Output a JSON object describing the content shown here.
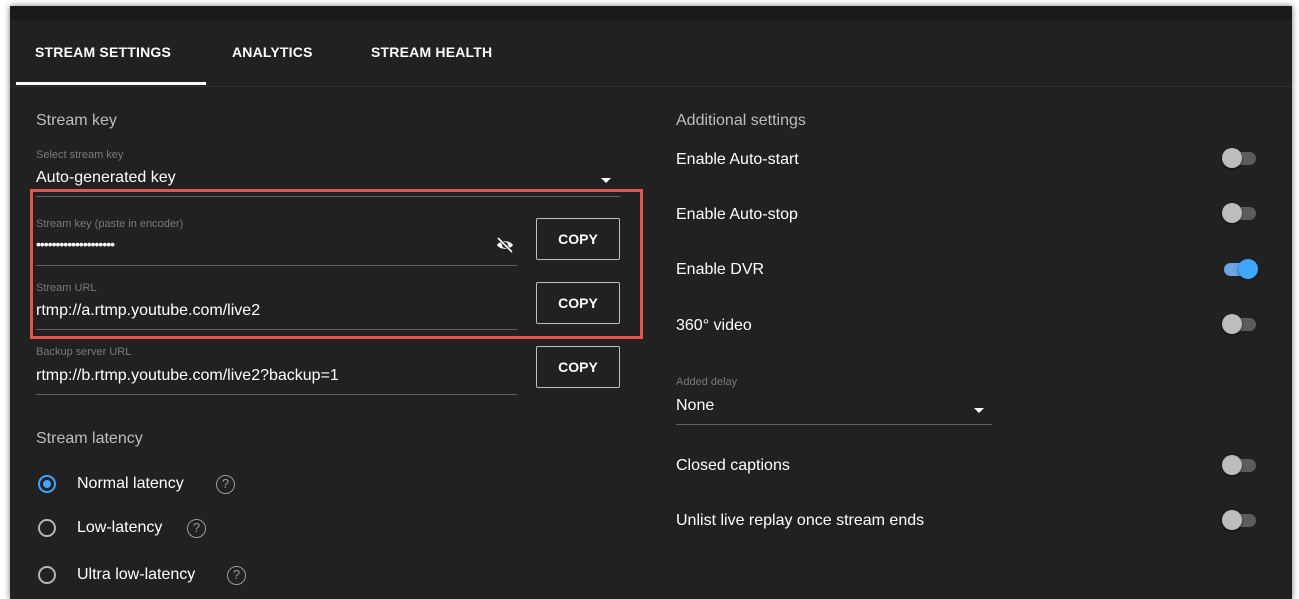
{
  "tabs": [
    {
      "label": "STREAM SETTINGS",
      "active": true
    },
    {
      "label": "ANALYTICS",
      "active": false
    },
    {
      "label": "STREAM HEALTH",
      "active": false
    }
  ],
  "stream_key_section": {
    "title": "Stream key",
    "select_label": "Select stream key",
    "select_value": "Auto-generated key",
    "key_label": "Stream key (paste in encoder)",
    "key_value": "••••••••••••••••••••",
    "stream_url_label": "Stream URL",
    "stream_url_value": "rtmp://a.rtmp.youtube.com/live2",
    "backup_label": "Backup server URL",
    "backup_value": "rtmp://b.rtmp.youtube.com/live2?backup=1",
    "copy_label": "COPY"
  },
  "latency": {
    "title": "Stream latency",
    "options": [
      {
        "label": "Normal latency",
        "selected": true
      },
      {
        "label": "Low-latency",
        "selected": false
      },
      {
        "label": "Ultra low-latency",
        "selected": false
      }
    ],
    "help_glyph": "?"
  },
  "additional": {
    "title": "Additional settings",
    "toggles": [
      {
        "label": "Enable Auto-start",
        "on": false
      },
      {
        "label": "Enable Auto-stop",
        "on": false
      },
      {
        "label": "Enable DVR",
        "on": true
      },
      {
        "label": "360° video",
        "on": false
      }
    ],
    "delay_label": "Added delay",
    "delay_value": "None",
    "toggles2": [
      {
        "label": "Closed captions",
        "on": false
      },
      {
        "label": "Unlist live replay once stream ends",
        "on": false
      }
    ]
  },
  "colors": {
    "background": "#212121",
    "accent": "#3ea6ff",
    "highlight": "#e2574c"
  },
  "icons": {
    "visibility": "eye-off-icon",
    "dropdown": "caret-down-icon",
    "help": "help-circle-icon"
  }
}
